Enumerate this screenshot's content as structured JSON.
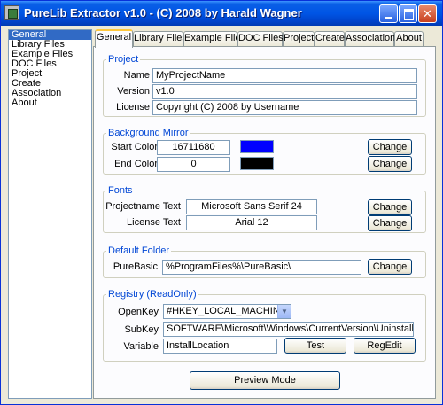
{
  "window": {
    "title": "PureLib Extractor v1.0 - (C) 2008 by Harald Wagner"
  },
  "nav": {
    "items": [
      "General",
      "Library Files",
      "Example Files",
      "DOC Files",
      "Project",
      "Create",
      "Association",
      "About"
    ],
    "selected": "General"
  },
  "tabs": [
    "General",
    "Library Files",
    "Example Files",
    "DOC Files",
    "Project",
    "Create",
    "Association",
    "About"
  ],
  "project": {
    "title": "Project",
    "name_label": "Name",
    "name_value": "MyProjectName",
    "version_label": "Version",
    "version_value": "v1.0",
    "license_label": "License",
    "license_value": "Copyright (C) 2008 by Username"
  },
  "background": {
    "title": "Background Mirror",
    "start_label": "Start Color",
    "start_value": "16711680",
    "start_swatch": "#0000ff",
    "end_label": "End Color",
    "end_value": "0",
    "end_swatch": "#000000",
    "change_label": "Change"
  },
  "fonts": {
    "title": "Fonts",
    "projectname_label": "Projectname Text",
    "projectname_value": "Microsoft Sans Serif 24",
    "license_label": "License Text",
    "license_value": "Arial 12",
    "change_label": "Change"
  },
  "default_folder": {
    "title": "Default Folder",
    "purebasic_label": "PureBasic",
    "purebasic_value": "%ProgramFiles%\\PureBasic\\",
    "change_label": "Change"
  },
  "registry": {
    "title": "Registry (ReadOnly)",
    "openkey_label": "OpenKey",
    "openkey_value": "#HKEY_LOCAL_MACHINE",
    "subkey_label": "SubKey",
    "subkey_value": "SOFTWARE\\Microsoft\\Windows\\CurrentVersion\\Uninstall\\PureBasic_",
    "variable_label": "Variable",
    "variable_value": "InstallLocation",
    "test_label": "Test",
    "regedit_label": "RegEdit"
  },
  "preview_label": "Preview Mode"
}
